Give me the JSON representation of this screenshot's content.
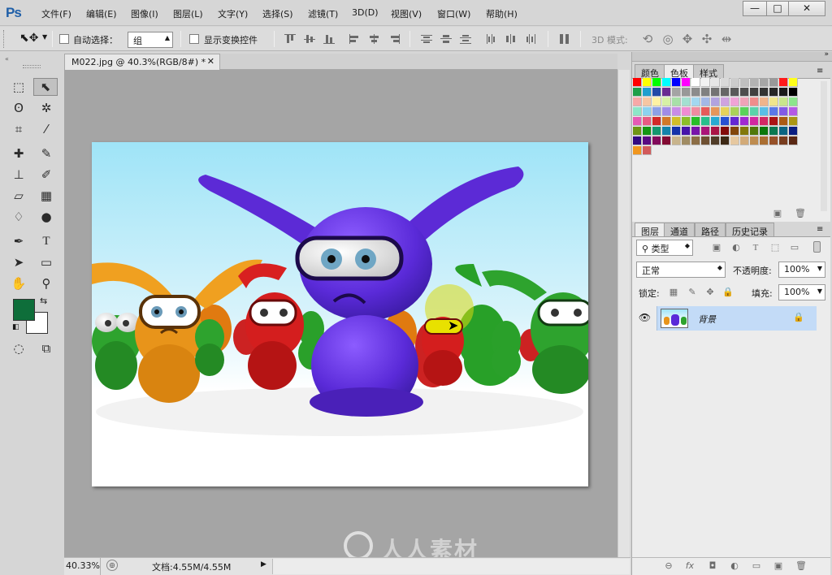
{
  "app": {
    "logo": "Ps"
  },
  "menu": [
    {
      "label": "文件(F)"
    },
    {
      "label": "编辑(E)"
    },
    {
      "label": "图像(I)"
    },
    {
      "label": "图层(L)"
    },
    {
      "label": "文字(Y)"
    },
    {
      "label": "选择(S)"
    },
    {
      "label": "滤镜(T)"
    },
    {
      "label": "3D(D)"
    },
    {
      "label": "视图(V)"
    },
    {
      "label": "窗口(W)"
    },
    {
      "label": "帮助(H)"
    }
  ],
  "window_controls": {
    "minimize": "—",
    "maximize": "□",
    "close": "✕"
  },
  "options": {
    "auto_select_label": "自动选择：",
    "auto_select_checked": false,
    "auto_select_value": "组",
    "show_transform_label": "显示变换控件",
    "show_transform_checked": false,
    "mode_3d_label": "3D 模式:"
  },
  "document": {
    "tab_title": "M022.jpg @ 40.3%(RGB/8#) *",
    "zoom": "40.33%",
    "doc_size": "文档:4.55M/4.55M"
  },
  "colors": {
    "foreground": "#0e6e3a",
    "background": "#ffffff",
    "accent_selection": "#c3dbf7"
  },
  "swatch_panel": {
    "tabs": [
      {
        "label": "颜色"
      },
      {
        "label": "色板",
        "active": true
      },
      {
        "label": "样式"
      }
    ]
  },
  "swatches": [
    [
      "#ff0000",
      "#ffff00",
      "#00ff00",
      "#00ffff",
      "#0000ff",
      "#ff00ff",
      "#ffffff",
      "#f2f2f2",
      "#e6e6e6",
      "#d9d9d9",
      "#cccccc",
      "#bfbfbf",
      "#b3b3b3",
      "#a6a6a6",
      "#999999",
      "#ff1a1a",
      "#ffff1a"
    ],
    [
      "#1f9f4a",
      "#1f9fcf",
      "#234aa8",
      "#6a2a92",
      "#a4a4a4",
      "#989898",
      "#8c8c8c",
      "#808080",
      "#737373",
      "#666666",
      "#595959",
      "#4d4d4d",
      "#404040",
      "#333333",
      "#262626",
      "#1a1a1a",
      "#000000"
    ],
    [
      "#f7a8a8",
      "#f7c6a3",
      "#fff2a3",
      "#d7f0a6",
      "#a8e0a8",
      "#a3e0d1",
      "#a3d8f0",
      "#a3b8e6",
      "#b2a3e0",
      "#cfa3e0",
      "#f0a3d7",
      "#f0a3b8",
      "#f08c8c",
      "#f0b48c",
      "#f0e68c",
      "#c8e68c",
      "#8ce68c"
    ],
    [
      "#8ce6c8",
      "#8cd2f0",
      "#8ca0e6",
      "#a08ce6",
      "#c88ce6",
      "#f08cd2",
      "#f08ca0",
      "#e65a5a",
      "#e6965a",
      "#e6d25a",
      "#aad25a",
      "#5ad25a",
      "#5ad2aa",
      "#5abee6",
      "#5a78e6",
      "#825ae6",
      "#b45ae6"
    ],
    [
      "#e65ab4",
      "#e65a82",
      "#d22828",
      "#d27828",
      "#d2be28",
      "#8cbe28",
      "#28be28",
      "#28be8c",
      "#28aad2",
      "#2850d2",
      "#6428d2",
      "#a028d2",
      "#d228a0",
      "#d22864",
      "#aa1414",
      "#aa5a14",
      "#aa9614"
    ],
    [
      "#6e9614",
      "#149614",
      "#14966e",
      "#1482aa",
      "#1432aa",
      "#4614aa",
      "#7814aa",
      "#aa1478",
      "#aa1446",
      "#820a0a",
      "#82460a",
      "#82780a",
      "#50780a",
      "#0a780a",
      "#0a7850",
      "#0a6482",
      "#0a1e82"
    ],
    [
      "#320a82",
      "#5a0a82",
      "#820a5a",
      "#820a32",
      "#c8b48c",
      "#a08c64",
      "#8c6e46",
      "#6e5032",
      "#503c28",
      "#3c2814",
      "#e6c8a0",
      "#d2aa78",
      "#be8c50",
      "#aa6e32",
      "#965028",
      "#783c1e",
      "#5a2814"
    ],
    [
      "#f0961e",
      "#d25a5a"
    ]
  ],
  "layers_panel": {
    "tabs": [
      {
        "label": "图层",
        "active": true
      },
      {
        "label": "通道"
      },
      {
        "label": "路径"
      },
      {
        "label": "历史记录"
      }
    ],
    "kind_filter": "类型",
    "blend_mode": "正常",
    "opacity_label": "不透明度:",
    "opacity": "100%",
    "lock_label": "锁定:",
    "fill_label": "填充:",
    "fill": "100%",
    "layers": [
      {
        "name": "背景",
        "visible": true,
        "locked": true
      }
    ]
  },
  "watermark": "人人素材",
  "icons": {
    "eye": "eye-icon",
    "lock": "lock-icon",
    "link": "link-icon",
    "fx": "fx-icon",
    "mask": "mask-icon",
    "adjust": "adjustment-icon",
    "folder": "folder-icon",
    "new_layer": "new-layer-icon",
    "trash": "trash-icon"
  }
}
